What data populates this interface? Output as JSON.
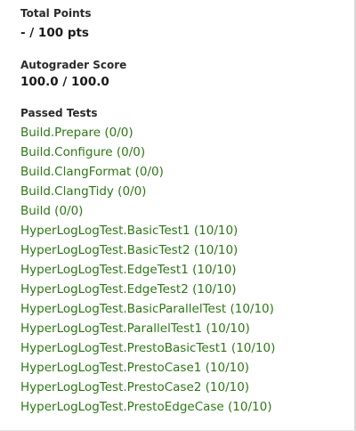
{
  "total_points": {
    "label": "Total Points",
    "value": "- / 100 pts"
  },
  "autograder": {
    "label": "Autograder Score",
    "value": "100.0 / 100.0"
  },
  "passed_tests": {
    "label": "Passed Tests",
    "color": "#2b7a12",
    "items": [
      "Build.Prepare (0/0)",
      "Build.Configure (0/0)",
      "Build.ClangFormat (0/0)",
      "Build.ClangTidy (0/0)",
      "Build (0/0)",
      "HyperLogLogTest.BasicTest1 (10/10)",
      "HyperLogLogTest.BasicTest2 (10/10)",
      "HyperLogLogTest.EdgeTest1 (10/10)",
      "HyperLogLogTest.EdgeTest2 (10/10)",
      "HyperLogLogTest.BasicParallelTest (10/10)",
      "HyperLogLogTest.ParallelTest1 (10/10)",
      "HyperLogLogTest.PrestoBasicTest1 (10/10)",
      "HyperLogLogTest.PrestoCase1 (10/10)",
      "HyperLogLogTest.PrestoCase2 (10/10)",
      "HyperLogLogTest.PrestoEdgeCase (10/10)"
    ]
  }
}
